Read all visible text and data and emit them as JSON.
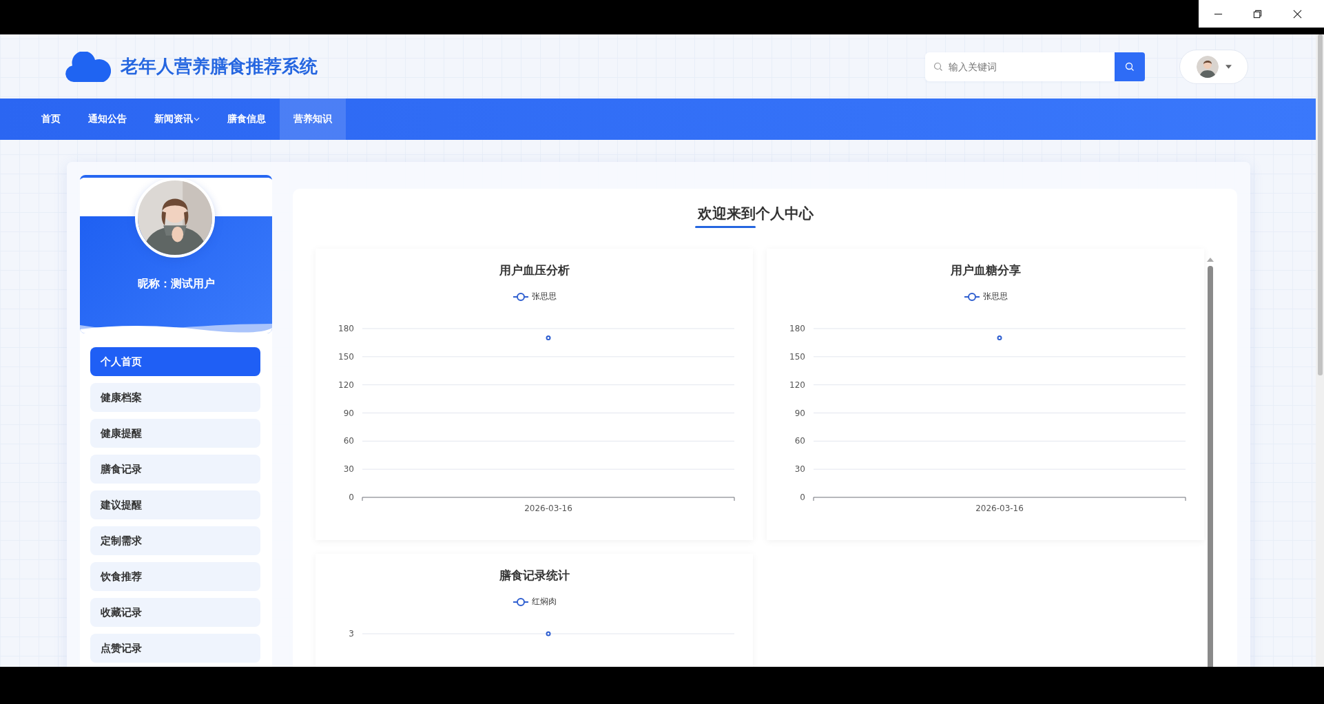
{
  "header": {
    "title": "老年人营养膳食推荐系统",
    "search": {
      "placeholder": "输入关键词"
    }
  },
  "nav": [
    {
      "label": "首页",
      "selected": false,
      "dropdown": false
    },
    {
      "label": "通知公告",
      "selected": false,
      "dropdown": false
    },
    {
      "label": "新闻资讯",
      "selected": false,
      "dropdown": true
    },
    {
      "label": "膳食信息",
      "selected": false,
      "dropdown": false
    },
    {
      "label": "营养知识",
      "selected": true,
      "dropdown": false
    }
  ],
  "profile": {
    "nickname": "昵称：测试用户"
  },
  "menu": [
    {
      "label": "个人首页",
      "selected": true
    },
    {
      "label": "健康档案",
      "selected": false
    },
    {
      "label": "健康提醒",
      "selected": false
    },
    {
      "label": "膳食记录",
      "selected": false
    },
    {
      "label": "建议提醒",
      "selected": false
    },
    {
      "label": "定制需求",
      "selected": false
    },
    {
      "label": "饮食推荐",
      "selected": false
    },
    {
      "label": "收藏记录",
      "selected": false
    },
    {
      "label": "点赞记录",
      "selected": false
    }
  ],
  "content": {
    "title": "欢迎来到个人中心",
    "charts": [
      {
        "chart_data": {
          "type": "line",
          "title": "用户血压分析",
          "categories": [
            "2026-03-16"
          ],
          "series": [
            {
              "name": "张思思",
              "color": "#2f5fd0",
              "marker": "circle",
              "values": [
                170
              ]
            }
          ],
          "ylim": [
            0,
            180
          ],
          "yticks": [
            0,
            30,
            60,
            90,
            120,
            150,
            180
          ],
          "grid": true
        }
      },
      {
        "chart_data": {
          "type": "line",
          "title": "用户血糖分享",
          "categories": [
            "2026-03-16"
          ],
          "series": [
            {
              "name": "张思思",
              "color": "#2f5fd0",
              "marker": "circle",
              "values": [
                170
              ]
            }
          ],
          "ylim": [
            0,
            180
          ],
          "yticks": [
            0,
            30,
            60,
            90,
            120,
            150,
            180
          ],
          "grid": true
        }
      },
      {
        "title": "膳食记录统计",
        "legend": [
          "红焖肉"
        ],
        "axis_labels": [
          "3"
        ]
      }
    ]
  }
}
